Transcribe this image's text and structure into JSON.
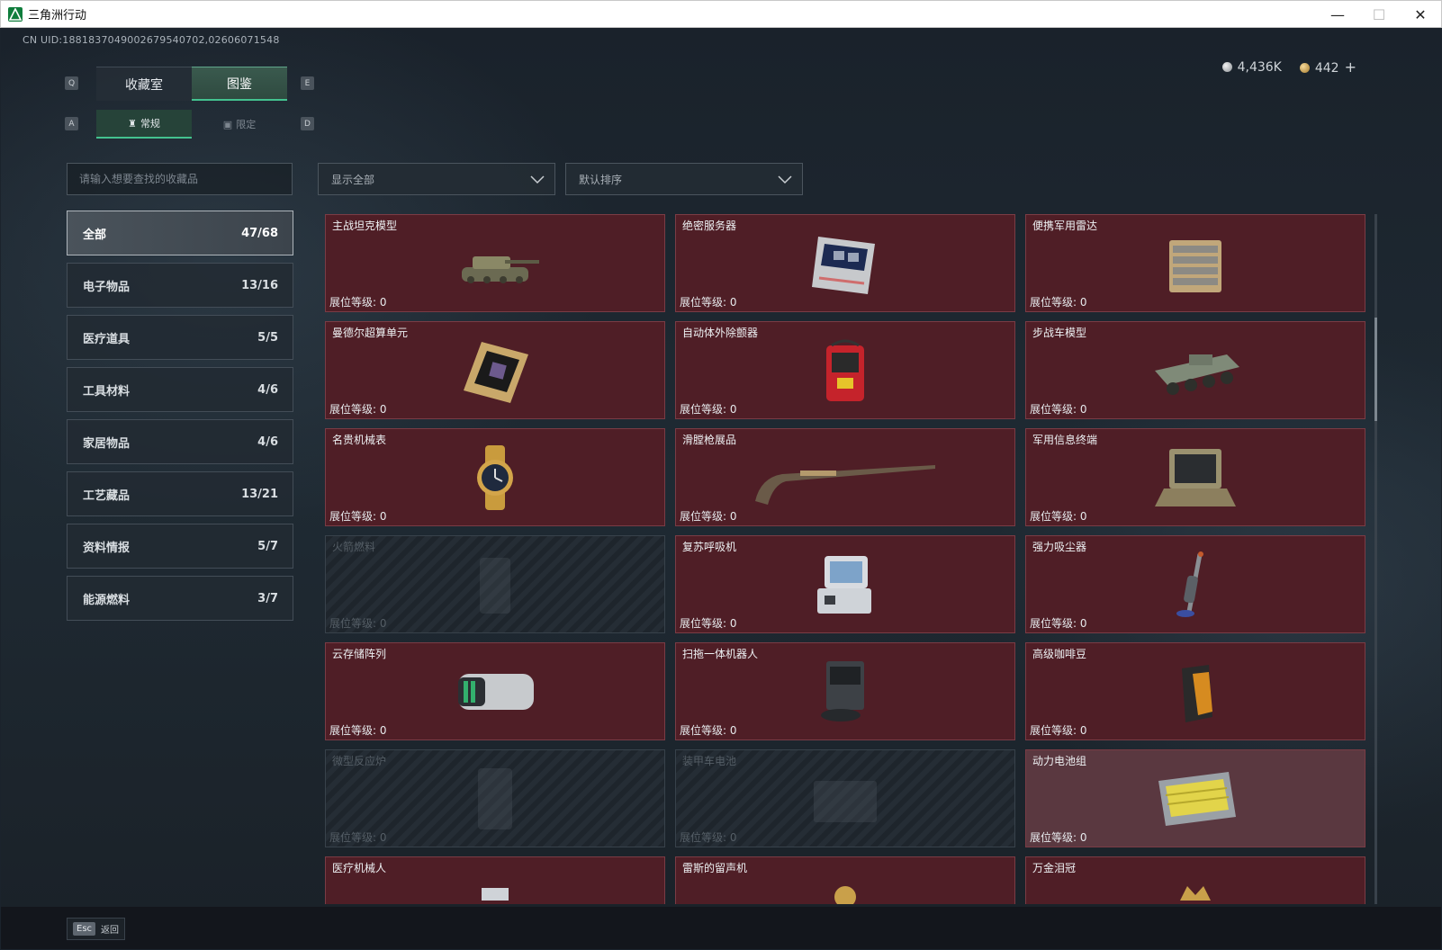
{
  "window": {
    "title": "三角洲行动",
    "minimize": "—",
    "maximize": "☐",
    "close": "✕"
  },
  "uid": "CN UID:1881837049002679540702,02606071548",
  "currency": {
    "silver": "4,436K",
    "gold": "442",
    "plus": "+"
  },
  "keys": {
    "q": "Q",
    "e": "E",
    "a": "A",
    "d": "D"
  },
  "tabs_main": [
    {
      "label": "收藏室"
    },
    {
      "label": "图鉴"
    }
  ],
  "tabs_sub": [
    {
      "label": "常规"
    },
    {
      "label": "限定"
    }
  ],
  "search": {
    "placeholder": "请输入想要查找的收藏品"
  },
  "filters": {
    "show": "显示全部",
    "sort": "默认排序"
  },
  "categories": [
    {
      "label": "全部",
      "count": "47/68"
    },
    {
      "label": "电子物品",
      "count": "13/16"
    },
    {
      "label": "医疗道具",
      "count": "5/5"
    },
    {
      "label": "工具材料",
      "count": "4/6"
    },
    {
      "label": "家居物品",
      "count": "4/6"
    },
    {
      "label": "工艺藏品",
      "count": "13/21"
    },
    {
      "label": "资料情报",
      "count": "5/7"
    },
    {
      "label": "能源燃料",
      "count": "3/7"
    }
  ],
  "level_prefix": "展位等级:",
  "items": [
    {
      "name": "主战坦克模型",
      "level": "0",
      "icon": "tank-model-icon"
    },
    {
      "name": "绝密服务器",
      "level": "0",
      "icon": "server-icon"
    },
    {
      "name": "便携军用雷达",
      "level": "0",
      "icon": "radar-icon"
    },
    {
      "name": "曼德尔超算单元",
      "level": "0",
      "icon": "supercomputer-unit-icon"
    },
    {
      "name": "自动体外除颤器",
      "level": "0",
      "icon": "defibrillator-icon"
    },
    {
      "name": "步战车模型",
      "level": "0",
      "icon": "ifv-model-icon"
    },
    {
      "name": "名贵机械表",
      "level": "0",
      "icon": "watch-icon"
    },
    {
      "name": "滑膛枪展品",
      "level": "0",
      "icon": "musket-icon"
    },
    {
      "name": "军用信息终端",
      "level": "0",
      "icon": "terminal-icon"
    },
    {
      "name": "火箭燃料",
      "level": "0",
      "icon": "rocket-fuel-icon"
    },
    {
      "name": "复苏呼吸机",
      "level": "0",
      "icon": "ventilator-icon"
    },
    {
      "name": "强力吸尘器",
      "level": "0",
      "icon": "vacuum-icon"
    },
    {
      "name": "云存储阵列",
      "level": "0",
      "icon": "storage-array-icon"
    },
    {
      "name": "扫拖一体机器人",
      "level": "0",
      "icon": "robot-mop-icon"
    },
    {
      "name": "高级咖啡豆",
      "level": "0",
      "icon": "coffee-beans-icon"
    },
    {
      "name": "微型反应炉",
      "level": "0",
      "icon": "micro-reactor-icon"
    },
    {
      "name": "装甲车电池",
      "level": "0",
      "icon": "armored-battery-icon"
    },
    {
      "name": "动力电池组",
      "level": "0",
      "icon": "power-battery-icon"
    },
    {
      "name": "医疗机械人",
      "level": "",
      "icon": "medical-robot-icon"
    },
    {
      "name": "雷斯的留声机",
      "level": "",
      "icon": "gramophone-icon"
    },
    {
      "name": "万金泪冠",
      "level": "",
      "icon": "crown-icon"
    }
  ],
  "footer": {
    "esc_key": "Esc",
    "back": "返回"
  },
  "colors": {
    "accent": "#43c28f",
    "card": "#4f1e26",
    "locked": "#252d35"
  }
}
